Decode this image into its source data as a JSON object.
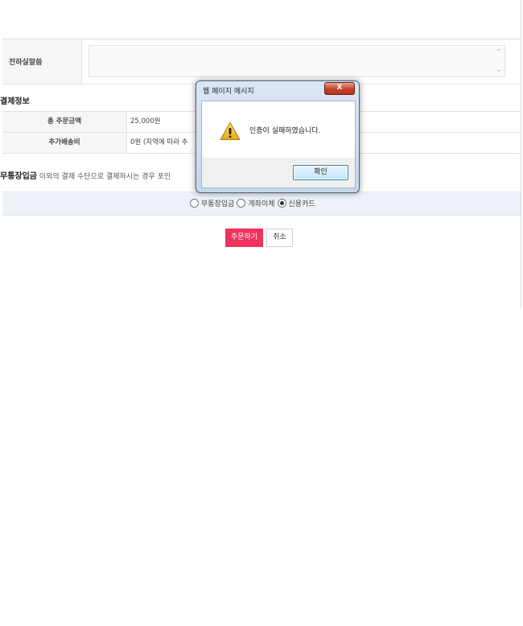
{
  "message": {
    "label": "전하실말씀"
  },
  "payment_info": {
    "title": "결제정보",
    "rows": [
      {
        "label": "총 주문금액",
        "value": "25,000원"
      },
      {
        "label": "추가배송비",
        "value": "0원 (지역에 따라 추"
      }
    ]
  },
  "notice": {
    "bold": "무통장입금",
    "text": " 이외의 결제 수단으로 결제하시는 경우 포인"
  },
  "payment_methods": {
    "options": [
      "무통장입금",
      "계좌이체",
      "신용카드"
    ],
    "selected": "신용카드"
  },
  "buttons": {
    "order": "주문하기",
    "cancel": "취소"
  },
  "dialog": {
    "title": "웹 페이지 메시지",
    "close": "X",
    "message": "인증이 실패하였습니다.",
    "ok": "확인",
    "icon": "warning-icon"
  },
  "colors": {
    "order_button": "#f0325f",
    "method_bar": "#eef2f8"
  }
}
